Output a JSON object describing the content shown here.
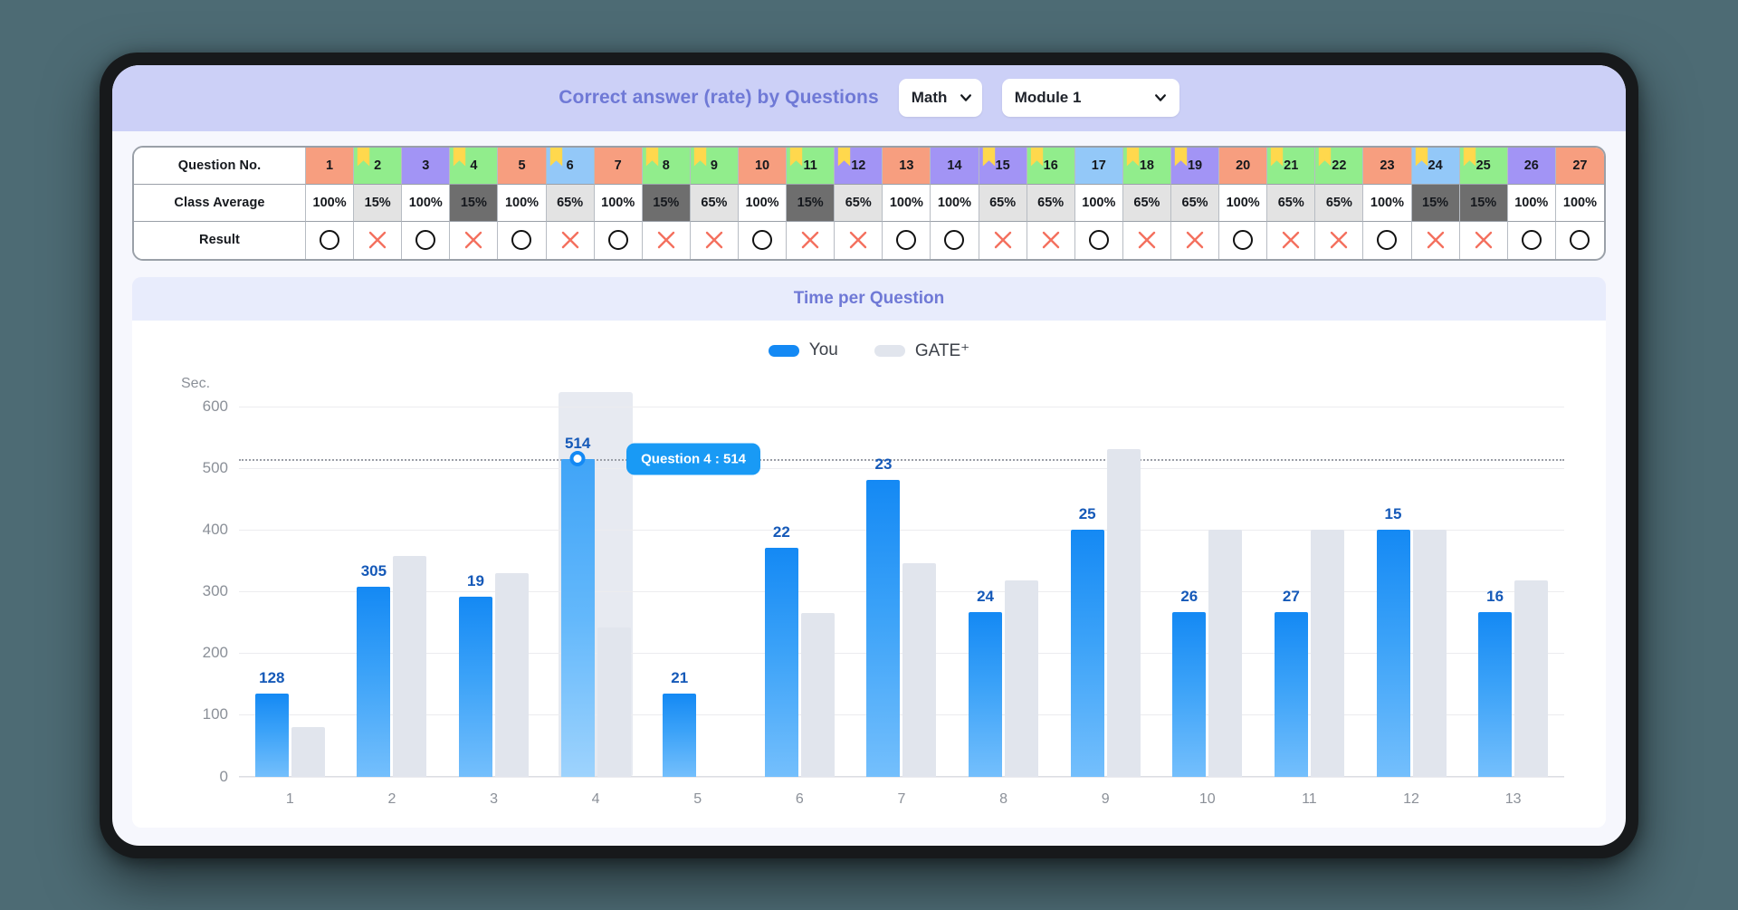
{
  "header": {
    "title": "Correct answer (rate) by Questions",
    "subject_select": {
      "value": "Math",
      "icon": "chevron-down-icon"
    },
    "module_select": {
      "value": "Module 1",
      "icon": "chevron-down-icon"
    }
  },
  "table": {
    "row_labels": [
      "Question No.",
      "Class Average",
      "Result"
    ],
    "questions": [
      {
        "no": "1",
        "color": "orange",
        "flag": false,
        "average": "100%",
        "avg_level": "100",
        "result": "correct"
      },
      {
        "no": "2",
        "color": "green",
        "flag": true,
        "average": "15%",
        "avg_level": "65",
        "result": "wrong"
      },
      {
        "no": "3",
        "color": "purple",
        "flag": false,
        "average": "100%",
        "avg_level": "100",
        "result": "correct"
      },
      {
        "no": "4",
        "color": "green",
        "flag": true,
        "average": "15%",
        "avg_level": "15",
        "result": "wrong"
      },
      {
        "no": "5",
        "color": "orange",
        "flag": false,
        "average": "100%",
        "avg_level": "100",
        "result": "correct"
      },
      {
        "no": "6",
        "color": "blue",
        "flag": true,
        "average": "65%",
        "avg_level": "65",
        "result": "wrong"
      },
      {
        "no": "7",
        "color": "orange",
        "flag": false,
        "average": "100%",
        "avg_level": "100",
        "result": "correct"
      },
      {
        "no": "8",
        "color": "green",
        "flag": true,
        "average": "15%",
        "avg_level": "15",
        "result": "wrong"
      },
      {
        "no": "9",
        "color": "green",
        "flag": true,
        "average": "65%",
        "avg_level": "65",
        "result": "wrong"
      },
      {
        "no": "10",
        "color": "orange",
        "flag": false,
        "average": "100%",
        "avg_level": "100",
        "result": "correct"
      },
      {
        "no": "11",
        "color": "green",
        "flag": true,
        "average": "15%",
        "avg_level": "15",
        "result": "wrong"
      },
      {
        "no": "12",
        "color": "purple",
        "flag": true,
        "average": "65%",
        "avg_level": "65",
        "result": "wrong"
      },
      {
        "no": "13",
        "color": "orange",
        "flag": false,
        "average": "100%",
        "avg_level": "100",
        "result": "correct"
      },
      {
        "no": "14",
        "color": "purple",
        "flag": false,
        "average": "100%",
        "avg_level": "100",
        "result": "correct"
      },
      {
        "no": "15",
        "color": "purple",
        "flag": true,
        "average": "65%",
        "avg_level": "65",
        "result": "wrong"
      },
      {
        "no": "16",
        "color": "green",
        "flag": true,
        "average": "65%",
        "avg_level": "65",
        "result": "wrong"
      },
      {
        "no": "17",
        "color": "blue",
        "flag": false,
        "average": "100%",
        "avg_level": "100",
        "result": "correct"
      },
      {
        "no": "18",
        "color": "green",
        "flag": true,
        "average": "65%",
        "avg_level": "65",
        "result": "wrong"
      },
      {
        "no": "19",
        "color": "purple",
        "flag": true,
        "average": "65%",
        "avg_level": "65",
        "result": "wrong"
      },
      {
        "no": "20",
        "color": "orange",
        "flag": false,
        "average": "100%",
        "avg_level": "100",
        "result": "correct"
      },
      {
        "no": "21",
        "color": "green",
        "flag": true,
        "average": "65%",
        "avg_level": "65",
        "result": "wrong"
      },
      {
        "no": "22",
        "color": "green",
        "flag": true,
        "average": "65%",
        "avg_level": "65",
        "result": "wrong"
      },
      {
        "no": "23",
        "color": "orange",
        "flag": false,
        "average": "100%",
        "avg_level": "100",
        "result": "correct"
      },
      {
        "no": "24",
        "color": "blue",
        "flag": true,
        "average": "15%",
        "avg_level": "15",
        "result": "wrong"
      },
      {
        "no": "25",
        "color": "green",
        "flag": true,
        "average": "15%",
        "avg_level": "15",
        "result": "wrong"
      },
      {
        "no": "26",
        "color": "purple",
        "flag": false,
        "average": "100%",
        "avg_level": "100",
        "result": "correct"
      },
      {
        "no": "27",
        "color": "orange",
        "flag": false,
        "average": "100%",
        "avg_level": "100",
        "result": "correct"
      }
    ]
  },
  "chart_section": {
    "title": "Time per Question",
    "tooltip": "Question 4 : 514"
  },
  "chart_data": {
    "type": "bar",
    "title": "Time per Question",
    "xlabel": "",
    "ylabel": "Sec.",
    "ylim": [
      0,
      600
    ],
    "yticks": [
      0,
      100,
      200,
      300,
      400,
      500,
      600
    ],
    "grid": true,
    "legend_position": "top-center",
    "categories": [
      "1",
      "2",
      "3",
      "4",
      "5",
      "6",
      "7",
      "8",
      "9",
      "10",
      "11",
      "12",
      "13"
    ],
    "point_labels": [
      "128",
      "305",
      "19",
      "514",
      "21",
      "22",
      "23",
      "24",
      "25",
      "26",
      "27",
      "15",
      "16"
    ],
    "highlight_index": 3,
    "highlight_value": 514,
    "reference_line": 514,
    "series": [
      {
        "name": "You",
        "color": "#1489f4",
        "values": [
          134,
          307,
          291,
          514,
          134,
          370,
          480,
          267,
          400,
          267,
          267,
          400,
          267
        ]
      },
      {
        "name": "GATE+",
        "color": "#e1e5ed",
        "values": [
          80,
          357,
          330,
          242,
          0,
          265,
          345,
          318,
          530,
          400,
          400,
          400,
          318
        ]
      }
    ]
  },
  "legend": [
    {
      "label": "You",
      "swatch": "#1489f4"
    },
    {
      "label": "GATE⁺",
      "swatch": "#e1e5ed"
    }
  ]
}
